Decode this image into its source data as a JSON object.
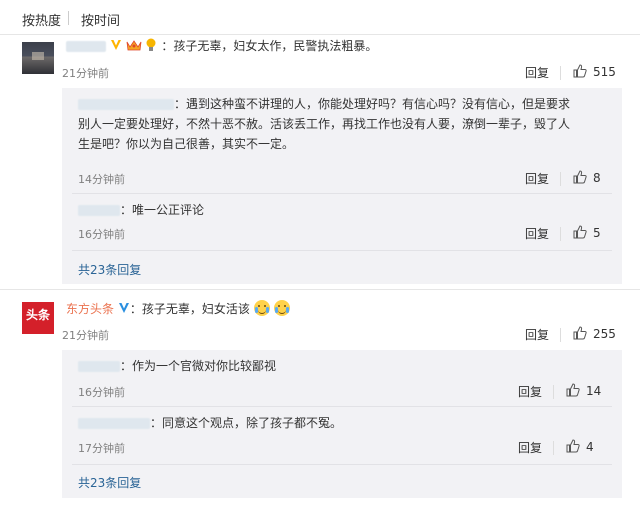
{
  "tabs": [
    {
      "label": "按热度",
      "active": true
    },
    {
      "label": "按时间",
      "active": false
    }
  ],
  "comment1": {
    "separator": "：",
    "text": "孩子无辜，妇女太作，民警执法粗暴。",
    "time": "21分钟前",
    "reply_label": "回复",
    "likes": "515",
    "replies": [
      {
        "separator": "：",
        "lines": [
          "遇到这种蛮不讲理的人，你能处理好吗？有信心吗？没有信心，但是要求",
          "别人一定要处理好，不然十恶不赦。活该丢工作，再找工作也没有人要，潦倒一辈子，毁了人",
          "生是吧？你以为自己很善，其实不一定。"
        ],
        "time": "14分钟前",
        "reply_label": "回复",
        "likes": "8"
      },
      {
        "separator": "：",
        "lines": [
          "唯一公正评论"
        ],
        "time": "16分钟前",
        "reply_label": "回复",
        "likes": "5"
      }
    ],
    "more_replies": "共23条回复"
  },
  "comment2": {
    "username": "东方头条",
    "avatar_text": "头条",
    "separator": "：",
    "text": "孩子无辜，妇女活该",
    "time": "21分钟前",
    "reply_label": "回复",
    "likes": "255",
    "replies": [
      {
        "separator": "：",
        "lines": [
          "作为一个官微对你比较鄙视"
        ],
        "time": "16分钟前",
        "reply_label": "回复",
        "likes": "14"
      },
      {
        "separator": "：",
        "lines": [
          "同意这个观点，除了孩子都不冤。"
        ],
        "time": "17分钟前",
        "reply_label": "回复",
        "likes": "4"
      }
    ],
    "more_replies": "共23条回复"
  },
  "colors": {
    "link_blue": "#2a6496",
    "username_orange": "#eb7350",
    "reply_bg": "#f2f2f5",
    "verified_badge": "#ffb400",
    "brand_red": "#d4202a"
  },
  "icons": [
    "thumbs-up-icon",
    "verified-badge-icon",
    "crown-icon",
    "bulb-icon",
    "crying-laugh-emoji-icon"
  ]
}
